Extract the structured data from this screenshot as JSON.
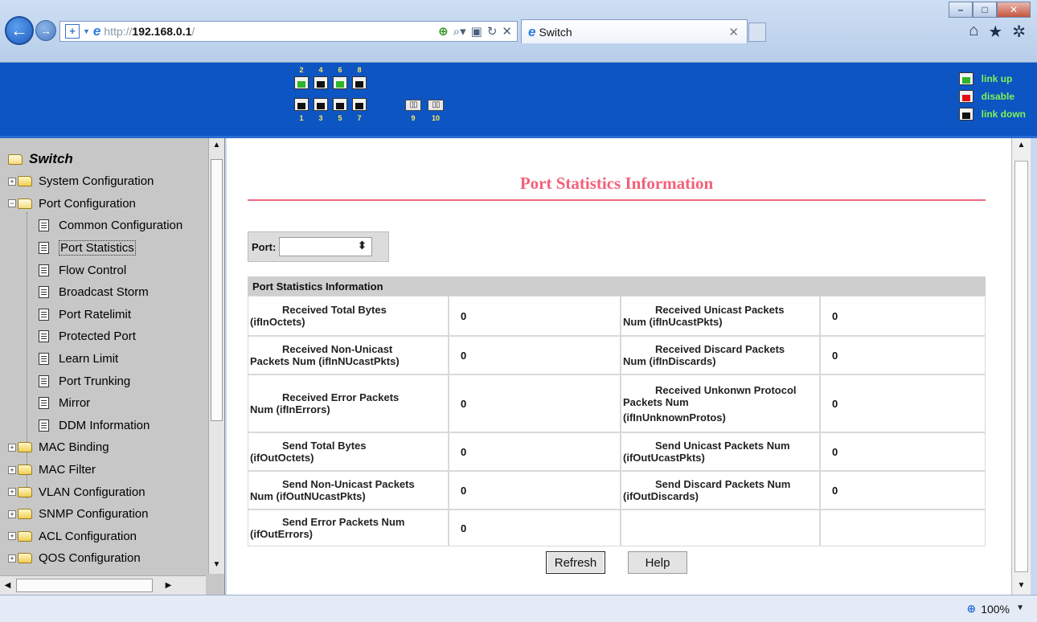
{
  "browser": {
    "address_prefix": "http://",
    "address_host": "192.168.0.1",
    "address_suffix": "/",
    "tab_title": "Switch",
    "window_buttons": {
      "minimize": "–",
      "maximize": "□",
      "close": "✕"
    }
  },
  "banner": {
    "top_port_labels": [
      "2",
      "4",
      "6",
      "8"
    ],
    "bottom_port_labels": [
      "1",
      "3",
      "5",
      "7",
      "9",
      "10"
    ],
    "legend": [
      {
        "label": "link up",
        "state": "up"
      },
      {
        "label": "disable",
        "state": "dis"
      },
      {
        "label": "link down",
        "state": "down"
      }
    ],
    "colors": {
      "banner_bg": "#0c55c2",
      "legend_text": "#7ff254",
      "port_label": "#ffe85a",
      "link_up": "#2fb52a",
      "disable": "#e21010"
    }
  },
  "sidebar": {
    "root": "Switch",
    "items": [
      {
        "label": "System Configuration",
        "level": 1,
        "expander": "+",
        "icon": "folder-icon"
      },
      {
        "label": "Port Configuration",
        "level": 1,
        "expander": "−",
        "icon": "open-folder-icon"
      },
      {
        "label": "Common Configuration",
        "level": 2,
        "icon": "document-icon"
      },
      {
        "label": "Port Statistics",
        "level": 2,
        "icon": "document-icon",
        "selected": true
      },
      {
        "label": "Flow Control",
        "level": 2,
        "icon": "document-icon"
      },
      {
        "label": "Broadcast Storm",
        "level": 2,
        "icon": "document-icon"
      },
      {
        "label": "Port Ratelimit",
        "level": 2,
        "icon": "document-icon"
      },
      {
        "label": "Protected Port",
        "level": 2,
        "icon": "document-icon"
      },
      {
        "label": "Learn Limit",
        "level": 2,
        "icon": "document-icon"
      },
      {
        "label": "Port Trunking",
        "level": 2,
        "icon": "document-icon"
      },
      {
        "label": "Mirror",
        "level": 2,
        "icon": "document-icon"
      },
      {
        "label": "DDM Information",
        "level": 2,
        "icon": "document-icon"
      },
      {
        "label": "MAC Binding",
        "level": 1,
        "expander": "+",
        "icon": "folder-icon"
      },
      {
        "label": "MAC Filter",
        "level": 1,
        "expander": "+",
        "icon": "folder-icon"
      },
      {
        "label": "VLAN Configuration",
        "level": 1,
        "expander": "+",
        "icon": "folder-icon"
      },
      {
        "label": "SNMP Configuration",
        "level": 1,
        "expander": "+",
        "icon": "folder-icon"
      },
      {
        "label": "ACL Configuration",
        "level": 1,
        "expander": "+",
        "icon": "folder-icon"
      },
      {
        "label": "QOS Configuration",
        "level": 1,
        "expander": "+",
        "icon": "folder-icon"
      }
    ]
  },
  "main": {
    "title": "Port Statistics Information",
    "port_label": "Port:",
    "port_value": "",
    "table_header": "Port Statistics Information",
    "rows": [
      {
        "l1": "Received Total Bytes",
        "l2": "(ifInOctets)",
        "v1": "0",
        "r1": "Received Unicast Packets",
        "r2": "Num (ifInUcastPkts)",
        "v2": "0"
      },
      {
        "l1": "Received Non-Unicast",
        "l2": "Packets Num (ifInNUcastPkts)",
        "v1": "0",
        "r1": "Received Discard Packets",
        "r2": "Num (ifInDiscards)",
        "v2": "0"
      },
      {
        "l1": "Received Error Packets",
        "l2": "Num (ifInErrors)",
        "v1": "0",
        "r1": "Received Unkonwn Protocol",
        "r2": "Packets Num",
        "r3": "(ifInUnknownProtos)",
        "v2": "0"
      },
      {
        "l1": "Send Total Bytes",
        "l2": "(ifOutOctets)",
        "v1": "0",
        "r1": "Send Unicast Packets Num",
        "r2": "(ifOutUcastPkts)",
        "v2": "0"
      },
      {
        "l1": "Send Non-Unicast Packets",
        "l2": "Num (ifOutNUcastPkts)",
        "v1": "0",
        "r1": "Send Discard Packets Num",
        "r2": "(ifOutDiscards)",
        "v2": "0"
      },
      {
        "l1": "Send Error Packets Num",
        "l2": "(ifOutErrors)",
        "v1": "0",
        "r1": "",
        "r2": "",
        "v2": ""
      }
    ],
    "refresh_label": "Refresh",
    "help_label": "Help",
    "title_color": "#f2617a"
  },
  "status": {
    "zoom": "100%"
  }
}
